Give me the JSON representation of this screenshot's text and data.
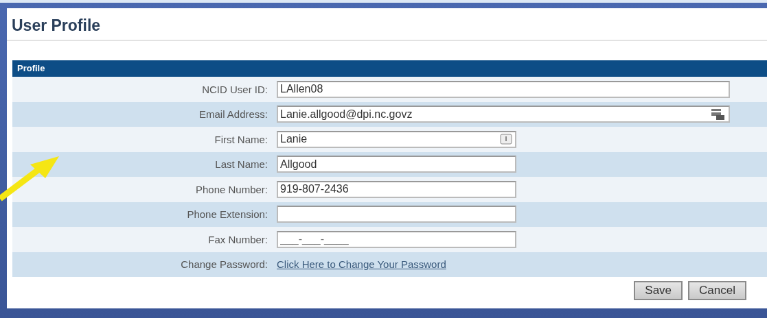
{
  "page": {
    "title": "User Profile"
  },
  "section": {
    "title": "Profile"
  },
  "rows": [
    {
      "label": "NCID User ID:",
      "kind": "long",
      "value": "LAllen08"
    },
    {
      "label": "Email Address:",
      "kind": "long",
      "value": "Lanie.allgood@dpi.nc.govz"
    },
    {
      "label": "First Name:",
      "kind": "short",
      "value": "Lanie"
    },
    {
      "label": "Last Name:",
      "kind": "short",
      "value": "Allgood"
    },
    {
      "label": "Phone Number:",
      "kind": "short",
      "value": "919-807-2436"
    },
    {
      "label": "Phone Extension:",
      "kind": "short",
      "value": ""
    },
    {
      "label": "Fax Number:",
      "kind": "short",
      "placeholder": "___-___-____"
    },
    {
      "label": "Change Password:",
      "kind": "link",
      "value": "Click Here to Change Your Password"
    }
  ],
  "buttons": [
    "Save",
    "Cancel"
  ]
}
